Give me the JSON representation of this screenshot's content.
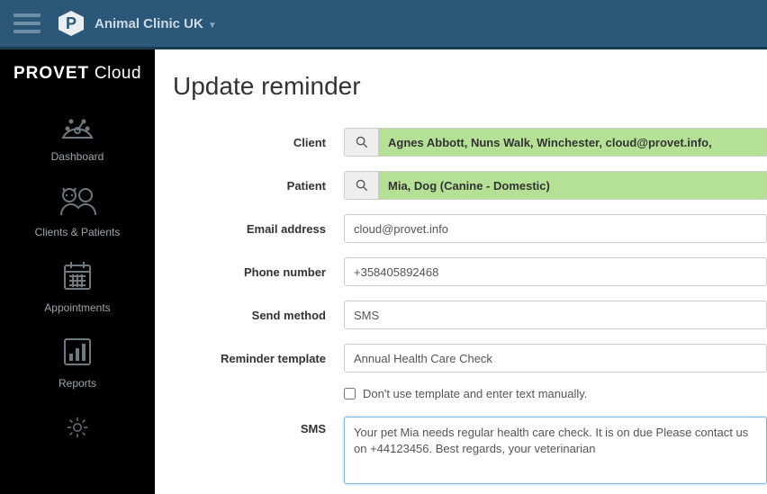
{
  "topbar": {
    "clinic": "Animal Clinic UK"
  },
  "brand": {
    "bold": "PROVET",
    "light": " Cloud"
  },
  "nav": [
    "Dashboard",
    "Clients & Patients",
    "Appointments",
    "Reports"
  ],
  "title": "Update reminder",
  "labels": {
    "client": "Client",
    "patient": "Patient",
    "email": "Email address",
    "phone": "Phone number",
    "method": "Send method",
    "template": "Reminder template",
    "manual": "Don't use template and enter text manually.",
    "sms": "SMS"
  },
  "values": {
    "client": "Agnes Abbott, Nuns Walk, Winchester, cloud@provet.info,",
    "patient": "Mia, Dog (Canine - Domestic)",
    "email": "cloud@provet.info",
    "phone": "+358405892468",
    "method": "SMS",
    "template": "Annual Health Care Check",
    "sms": "Your pet Mia needs regular health care check. It is on due Please contact us on +44123456. Best regards, your veterinarian"
  }
}
